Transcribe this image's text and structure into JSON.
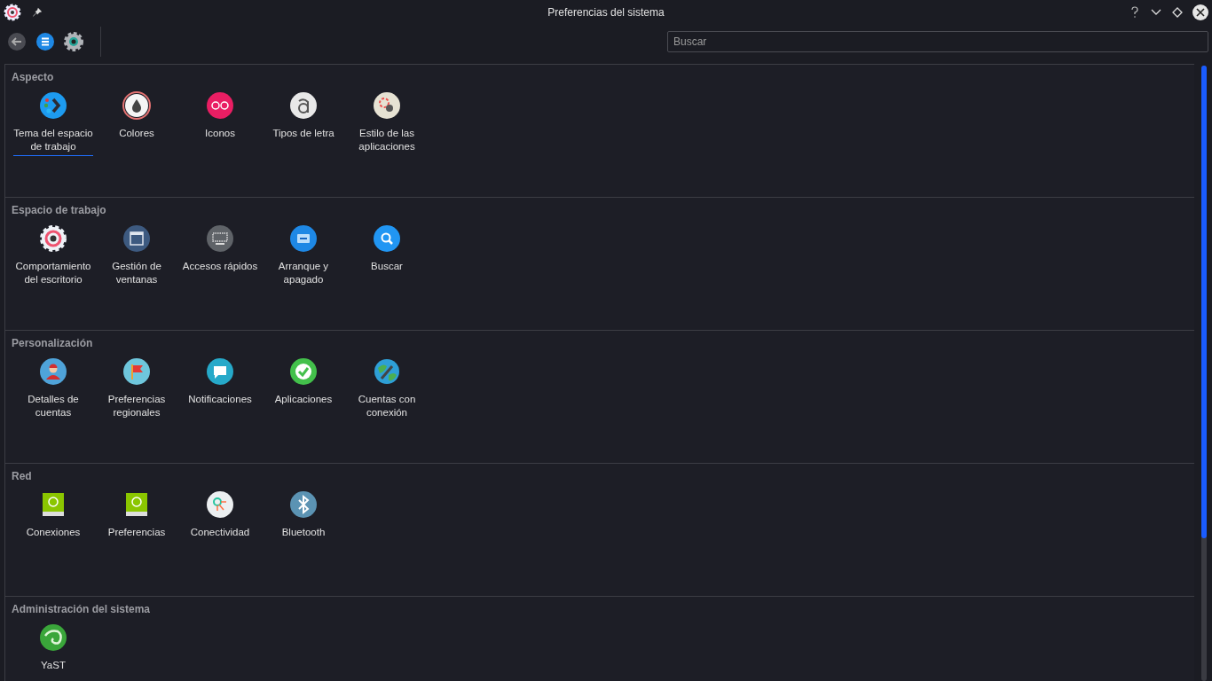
{
  "window": {
    "title": "Preferencias del sistema"
  },
  "search": {
    "placeholder": "Buscar"
  },
  "sections": [
    {
      "title": "Aspecto",
      "items": [
        {
          "label": "Tema del espacio de trabajo",
          "selected": true
        },
        {
          "label": "Colores",
          "selected": false
        },
        {
          "label": "Iconos",
          "selected": false
        },
        {
          "label": "Tipos de letra",
          "selected": false
        },
        {
          "label": "Estilo de las aplicaciones",
          "selected": false
        }
      ]
    },
    {
      "title": "Espacio de trabajo",
      "items": [
        {
          "label": "Comportamiento del escritorio",
          "selected": false
        },
        {
          "label": "Gestión de ventanas",
          "selected": false
        },
        {
          "label": "Accesos rápidos",
          "selected": false
        },
        {
          "label": "Arranque y apagado",
          "selected": false
        },
        {
          "label": "Buscar",
          "selected": false
        }
      ]
    },
    {
      "title": "Personalización",
      "items": [
        {
          "label": "Detalles de cuentas",
          "selected": false
        },
        {
          "label": "Preferencias regionales",
          "selected": false
        },
        {
          "label": "Notificaciones",
          "selected": false
        },
        {
          "label": "Aplicaciones",
          "selected": false
        },
        {
          "label": "Cuentas con conexión",
          "selected": false
        }
      ]
    },
    {
      "title": "Red",
      "items": [
        {
          "label": "Conexiones",
          "selected": false
        },
        {
          "label": "Preferencias",
          "selected": false
        },
        {
          "label": "Conectividad",
          "selected": false
        },
        {
          "label": "Bluetooth",
          "selected": false
        }
      ]
    },
    {
      "title": "Administración del sistema",
      "items": [
        {
          "label": "YaST",
          "selected": false
        }
      ]
    }
  ]
}
